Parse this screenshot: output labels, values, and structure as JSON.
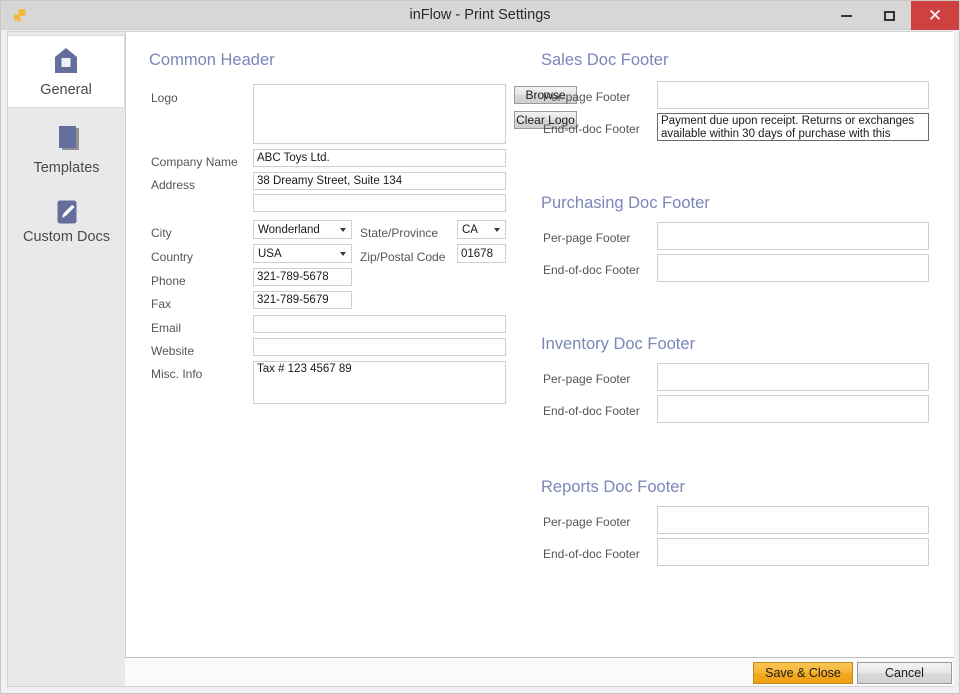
{
  "window": {
    "title": "inFlow - Print Settings",
    "app_icon": "inflow-puzzle-icon",
    "controls": {
      "minimize": "minimize-icon",
      "maximize": "maximize-icon",
      "close": "✕"
    }
  },
  "sidebar": {
    "items": [
      {
        "label": "General",
        "icon": "home-icon",
        "selected": true
      },
      {
        "label": "Templates",
        "icon": "pages-icon",
        "selected": false
      },
      {
        "label": "Custom Docs",
        "icon": "pencil-icon",
        "selected": false
      }
    ]
  },
  "common_header": {
    "title": "Common Header",
    "labels": {
      "logo": "Logo",
      "company_name": "Company Name",
      "address": "Address",
      "city": "City",
      "state_province": "State/Province",
      "country": "Country",
      "zip_postal_code": "Zip/Postal Code",
      "phone": "Phone",
      "fax": "Fax",
      "email": "Email",
      "website": "Website",
      "misc_info": "Misc. Info"
    },
    "buttons": {
      "browse": "Browse",
      "clear_logo": "Clear Logo"
    },
    "values": {
      "company_name": "ABC Toys Ltd.",
      "address_line1": "38 Dreamy Street, Suite 134",
      "address_line2": "",
      "city": "Wonderland",
      "state_province": "CA",
      "country": "USA",
      "zip_postal_code": "01678",
      "phone": "321-789-5678",
      "fax": "321-789-5679",
      "email": "",
      "website": "",
      "misc_info": "Tax # 123 4567 89"
    }
  },
  "footers": {
    "labels": {
      "per_page": "Per-page Footer",
      "end_of_doc": "End-of-doc Footer"
    },
    "sections": [
      {
        "title": "Sales Doc Footer",
        "per_page": "",
        "end_of_doc": "Payment due upon receipt. Returns or exchanges available within 30 days of purchase with this receipt. ",
        "end_of_doc_focused": true
      },
      {
        "title": "Purchasing Doc Footer",
        "per_page": "",
        "end_of_doc": "",
        "end_of_doc_focused": false
      },
      {
        "title": "Inventory Doc Footer",
        "per_page": "",
        "end_of_doc": "",
        "end_of_doc_focused": false
      },
      {
        "title": "Reports Doc Footer",
        "per_page": "",
        "end_of_doc": "",
        "end_of_doc_focused": false
      }
    ]
  },
  "actions": {
    "save": "Save & Close",
    "cancel": "Cancel"
  },
  "colors": {
    "section_heading": "#7b86b9",
    "sidebar_icon": "#636e9c",
    "save_button": "#f2a81f",
    "close_button": "#cf4040"
  }
}
